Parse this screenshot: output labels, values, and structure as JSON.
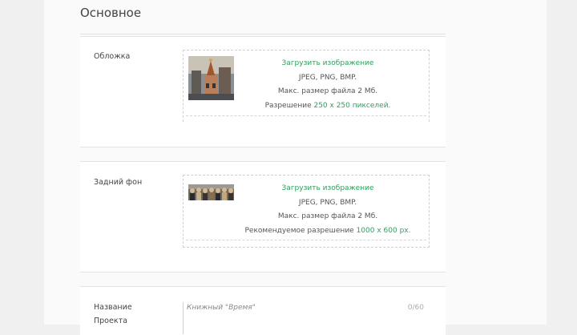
{
  "section": {
    "title": "Основное"
  },
  "cover": {
    "label": "Обложка",
    "upload_link": "Загрузить изображение",
    "formats": "JPEG, PNG, BMP.",
    "max_size": "Макс. размер файла 2 Мб.",
    "resolution_prefix": "Разрешение ",
    "resolution_value": "250 х 250 пикселей.",
    "thumb_icon": "church-photo-thumbnail"
  },
  "background": {
    "label": "Задний фон",
    "upload_link": "Загрузить изображение",
    "formats": "JPEG, PNG, BMP.",
    "max_size": "Макс. размер файла 2 Мб.",
    "resolution_prefix": "Рекомендуемое разрешение ",
    "resolution_value": "1000 х 600 px.",
    "thumb_icon": "group-photo-thumbnail"
  },
  "project_name": {
    "label_line1": "Название",
    "label_line2": "Проекта",
    "placeholder": "Книжный \"Время\"",
    "counter": "0/60"
  },
  "colors": {
    "accent": "#2e9e5e"
  }
}
